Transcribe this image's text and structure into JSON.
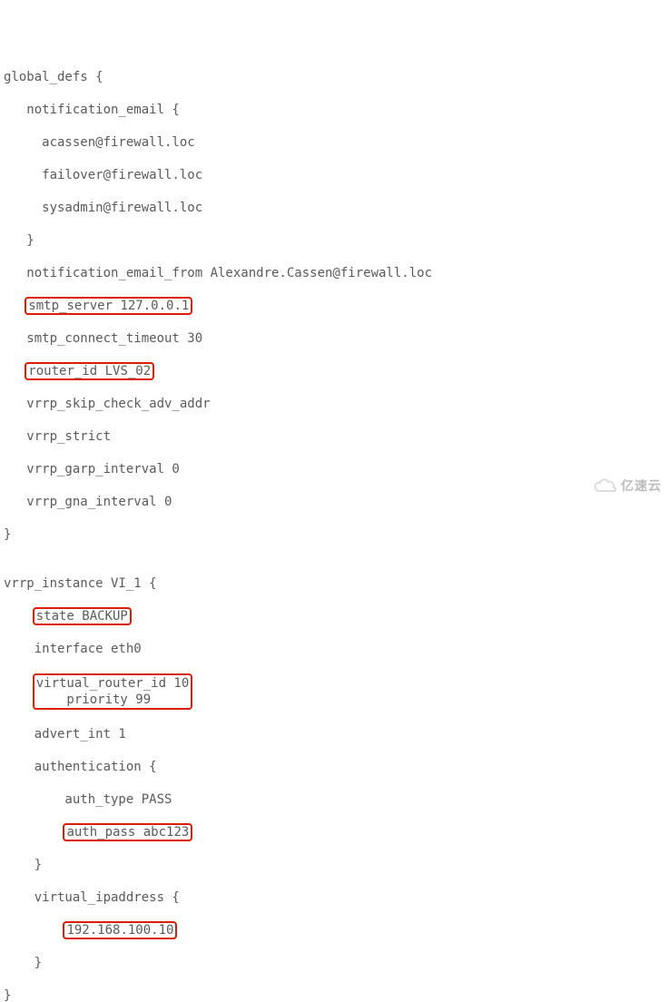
{
  "config": {
    "global_defs_open": "global_defs {",
    "notification_email_open": "   notification_email {",
    "email1": "     acassen@firewall.loc",
    "email2": "     failover@firewall.loc",
    "email3": "     sysadmin@firewall.loc",
    "notification_email_close": "   }",
    "notification_email_from": "   notification_email_from Alexandre.Cassen@firewall.loc",
    "smtp_server_prefix": "   ",
    "smtp_server": "smtp_server 127.0.0.1",
    "smtp_connect_timeout": "   smtp_connect_timeout 30",
    "router_id_prefix": "   ",
    "router_id": "router_id LVS_02",
    "vrrp_skip": "   vrrp_skip_check_adv_addr",
    "vrrp_strict": "   vrrp_strict",
    "vrrp_garp": "   vrrp_garp_interval 0",
    "vrrp_gna": "   vrrp_gna_interval 0",
    "global_defs_close": "}",
    "blank": "",
    "vrrp_instance_open": "vrrp_instance VI_1 {",
    "state_prefix": "    ",
    "state": "state BACKUP",
    "interface": "    interface eth0",
    "vr_pri_prefix": "    ",
    "virtual_router_id": "virtual_router_id 10",
    "priority": "    priority 99",
    "vr_pri_suffix": "",
    "advert_int": "    advert_int 1",
    "auth_open": "    authentication {",
    "auth_type": "        auth_type PASS",
    "auth_pass_prefix": "        ",
    "auth_pass": "auth_pass abc123",
    "auth_close": "    }",
    "vip_open": "    virtual_ipaddress {",
    "vip_prefix": "        ",
    "vip": "192.168.100.10",
    "vip_close": "    }",
    "vrrp_instance_close": "}"
  },
  "watermark": "亿速云"
}
